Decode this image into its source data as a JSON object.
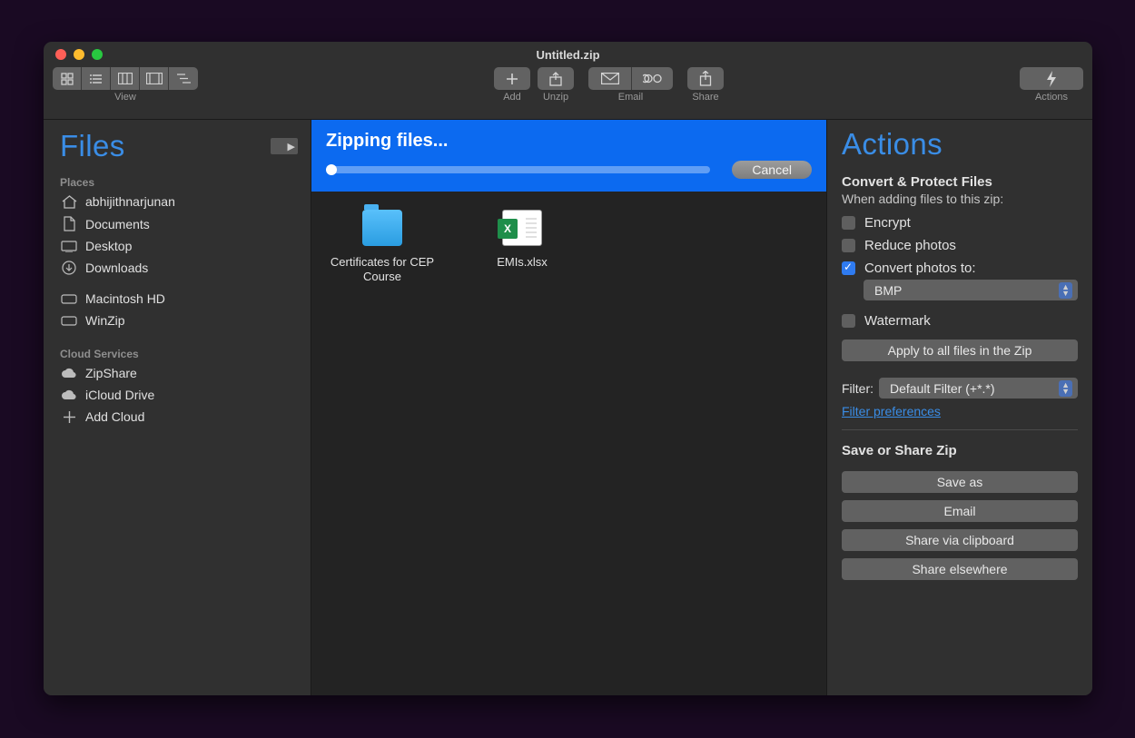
{
  "window": {
    "title": "Untitled.zip"
  },
  "toolbar": {
    "view_label": "View",
    "add_label": "Add",
    "unzip_label": "Unzip",
    "email_label": "Email",
    "share_label": "Share",
    "actions_label": "Actions"
  },
  "sidebar": {
    "title": "Files",
    "places_label": "Places",
    "places": [
      {
        "icon": "home-icon",
        "label": "abhijithnarjunan"
      },
      {
        "icon": "documents-icon",
        "label": "Documents"
      },
      {
        "icon": "desktop-icon",
        "label": "Desktop"
      },
      {
        "icon": "downloads-icon",
        "label": "Downloads"
      },
      {
        "icon": "drive-icon",
        "label": "Macintosh HD"
      },
      {
        "icon": "drive-icon",
        "label": "WinZip"
      }
    ],
    "cloud_label": "Cloud Services",
    "cloud": [
      {
        "icon": "cloud-icon",
        "label": "ZipShare"
      },
      {
        "icon": "cloud-icon",
        "label": "iCloud Drive"
      },
      {
        "icon": "plus-icon",
        "label": "Add Cloud"
      }
    ]
  },
  "progress": {
    "title": "Zipping files...",
    "percent": 2,
    "cancel_label": "Cancel"
  },
  "files": [
    {
      "type": "folder",
      "label": "Certificates for CEP Course"
    },
    {
      "type": "excel",
      "label": "EMIs.xlsx"
    }
  ],
  "actions": {
    "title": "Actions",
    "convert_head": "Convert & Protect Files",
    "convert_hint": "When adding files to this zip:",
    "encrypt_label": "Encrypt",
    "encrypt_checked": false,
    "reduce_label": "Reduce photos",
    "reduce_checked": false,
    "convert_label": "Convert photos to:",
    "convert_checked": true,
    "convert_format": "BMP",
    "watermark_label": "Watermark",
    "watermark_checked": false,
    "apply_label": "Apply to all files in the Zip",
    "filter_label": "Filter:",
    "filter_value": "Default Filter (+*.*)",
    "filter_prefs": "Filter preferences",
    "share_head": "Save or Share Zip",
    "save_as": "Save as",
    "email": "Email",
    "clipboard": "Share via clipboard",
    "elsewhere": "Share elsewhere"
  }
}
